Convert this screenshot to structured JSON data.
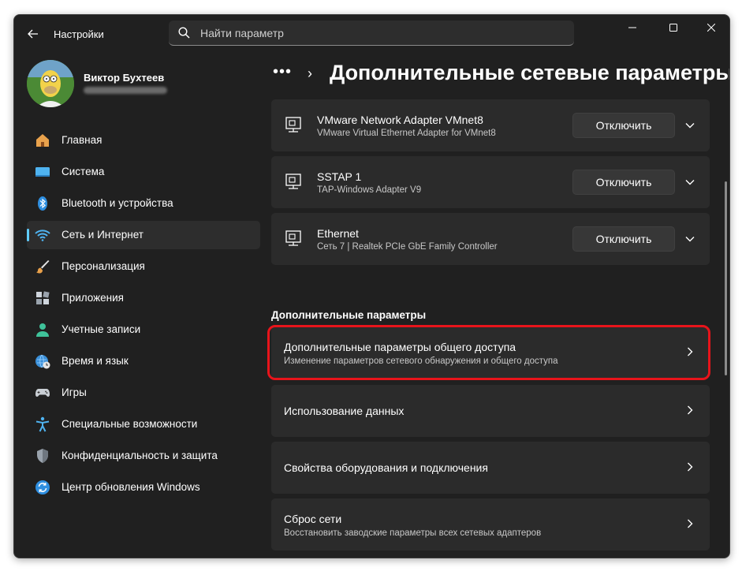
{
  "window": {
    "app_title": "Настройки",
    "search_placeholder": "Найти параметр"
  },
  "profile": {
    "name": "Виктор Бухтеев"
  },
  "sidebar": {
    "items": [
      {
        "label": "Главная",
        "icon": "home-icon"
      },
      {
        "label": "Система",
        "icon": "system-icon"
      },
      {
        "label": "Bluetooth и устройства",
        "icon": "bluetooth-icon"
      },
      {
        "label": "Сеть и Интернет",
        "icon": "wifi-icon",
        "active": true
      },
      {
        "label": "Персонализация",
        "icon": "brush-icon"
      },
      {
        "label": "Приложения",
        "icon": "apps-icon"
      },
      {
        "label": "Учетные записи",
        "icon": "person-icon"
      },
      {
        "label": "Время и язык",
        "icon": "globe-clock-icon"
      },
      {
        "label": "Игры",
        "icon": "gamepad-icon"
      },
      {
        "label": "Специальные возможности",
        "icon": "accessibility-icon"
      },
      {
        "label": "Конфиденциальность и защита",
        "icon": "shield-icon"
      },
      {
        "label": "Центр обновления Windows",
        "icon": "update-icon"
      }
    ]
  },
  "breadcrumb": {
    "dots": "•••",
    "separator": "›",
    "title": "Дополнительные сетевые параметры"
  },
  "adapters": [
    {
      "name": "VMware Network Adapter VMnet8",
      "description": "VMware Virtual Ethernet Adapter for VMnet8",
      "button": "Отключить"
    },
    {
      "name": "SSTAP 1",
      "description": "TAP-Windows Adapter V9",
      "button": "Отключить"
    },
    {
      "name": "Ethernet",
      "description": "Сеть 7 | Realtek PCIe GbE Family Controller",
      "button": "Отключить"
    }
  ],
  "more_settings": {
    "section_title": "Дополнительные параметры",
    "items": [
      {
        "title": "Дополнительные параметры общего доступа",
        "subtitle": "Изменение параметров сетевого обнаружения и общего доступа"
      },
      {
        "title": "Использование данных"
      },
      {
        "title": "Свойства оборудования и подключения"
      },
      {
        "title": "Сброс сети",
        "subtitle": "Восстановить заводские параметры всех сетевых адаптеров"
      }
    ]
  },
  "colors": {
    "accent": "#60cdff",
    "highlight": "#e8141b",
    "background": "#202020",
    "card": "#2b2b2b"
  }
}
